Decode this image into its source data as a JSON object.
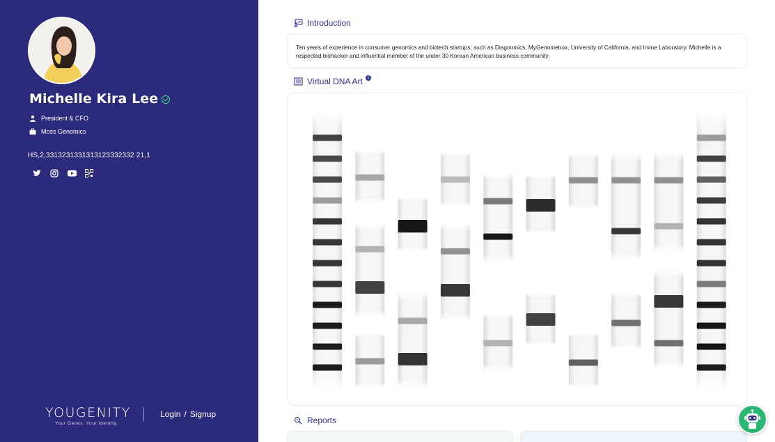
{
  "profile": {
    "name": "Michelle Kira Lee",
    "title": "President & CFO",
    "company": "Moss Genomics",
    "code": "HS,2,3313231331313123332332 21,1"
  },
  "socials": [
    {
      "icon": "twitter-icon"
    },
    {
      "icon": "instagram-icon"
    },
    {
      "icon": "youtube-icon"
    },
    {
      "icon": "qr-code-icon"
    }
  ],
  "brand": {
    "name": "YOUGENITY",
    "tagline": "Your Genes. Your Identity."
  },
  "auth": {
    "login": "Login",
    "separator": "/",
    "signup": "Signup"
  },
  "sections": {
    "introduction": {
      "title": "Introduction",
      "text": "Ten years of experience in consumer genomics and biotech startups, such as Diagnomics, MyGenomebox, University of California, and Irvine Laboratory. Michelle is a respected biohacker and influential member of the under 30 Korean American business community."
    },
    "dna_art": {
      "title": "Virtual DNA Art",
      "info_glyph": "i"
    },
    "reports": {
      "title": "Reports"
    }
  },
  "colors": {
    "sidebar": "#2c2a7a",
    "accent": "#2f3590",
    "verified": "#3ddc84",
    "chatbot": "#2bb673"
  },
  "dna_lanes": [
    {
      "lane": 1,
      "range": [
        160,
        560
      ],
      "bands": [
        [
          197,
          0.75
        ],
        [
          227,
          0.72
        ],
        [
          257,
          0.72
        ],
        [
          287,
          0.35
        ],
        [
          317,
          0.8
        ],
        [
          347,
          0.8
        ],
        [
          377,
          0.8
        ],
        [
          407,
          0.8
        ],
        [
          437,
          0.92
        ],
        [
          467,
          0.92
        ],
        [
          497,
          0.92
        ],
        [
          527,
          0.92
        ]
      ]
    },
    {
      "lane": 2,
      "range": [
        215,
        555
      ],
      "segments": [
        [
          215,
          290
        ],
        [
          320,
          455
        ],
        [
          478,
          555
        ]
      ],
      "bands": [
        [
          254,
          0.3
        ],
        [
          357,
          0.25
        ],
        [
          412,
          0.75
        ],
        [
          518,
          0.35
        ]
      ]
    },
    {
      "lane": 3,
      "range": [
        282,
        555
      ],
      "segments": [
        [
          282,
          360
        ],
        [
          420,
          555
        ]
      ],
      "bands": [
        [
          324,
          0.95
        ],
        [
          460,
          0.3
        ],
        [
          515,
          0.82
        ]
      ]
    },
    {
      "lane": 4,
      "range": [
        218,
        460
      ],
      "segments": [
        [
          218,
          295
        ],
        [
          320,
          460
        ]
      ],
      "bands": [
        [
          257,
          0.22
        ],
        [
          360,
          0.4
        ],
        [
          416,
          0.8
        ]
      ]
    },
    {
      "lane": 5,
      "range": [
        248,
        530
      ],
      "segments": [
        [
          248,
          375
        ],
        [
          450,
          530
        ]
      ],
      "bands": [
        [
          288,
          0.5
        ],
        [
          339,
          0.95
        ],
        [
          492,
          0.25
        ]
      ]
    },
    {
      "lane": 6,
      "range": [
        250,
        495
      ],
      "segments": [
        [
          250,
          335
        ],
        [
          420,
          495
        ]
      ],
      "bands": [
        [
          294,
          0.85
        ],
        [
          458,
          0.75
        ]
      ]
    },
    {
      "lane": 7,
      "range": [
        220,
        555
      ],
      "segments": [
        [
          220,
          298
        ],
        [
          478,
          555
        ]
      ],
      "bands": [
        [
          258,
          0.4
        ],
        [
          520,
          0.62
        ]
      ]
    },
    {
      "lane": 8,
      "range": [
        220,
        500
      ],
      "segments": [
        [
          220,
          372
        ],
        [
          420,
          500
        ]
      ],
      "bands": [
        [
          258,
          0.4
        ],
        [
          331,
          0.8
        ],
        [
          463,
          0.55
        ]
      ]
    },
    {
      "lane": 9,
      "range": [
        218,
        528
      ],
      "segments": [
        [
          218,
          360
        ],
        [
          388,
          528
        ]
      ],
      "bands": [
        [
          258,
          0.4
        ],
        [
          324,
          0.25
        ],
        [
          432,
          0.8
        ],
        [
          492,
          0.55
        ]
      ]
    },
    {
      "lane": 10,
      "range": [
        160,
        560
      ],
      "bands": [
        [
          197,
          0.35
        ],
        [
          227,
          0.75
        ],
        [
          257,
          0.62
        ],
        [
          287,
          0.78
        ],
        [
          317,
          0.82
        ],
        [
          347,
          0.82
        ],
        [
          377,
          0.82
        ],
        [
          407,
          0.5
        ],
        [
          437,
          0.92
        ],
        [
          467,
          0.95
        ],
        [
          497,
          0.95
        ],
        [
          527,
          0.92
        ]
      ]
    }
  ]
}
